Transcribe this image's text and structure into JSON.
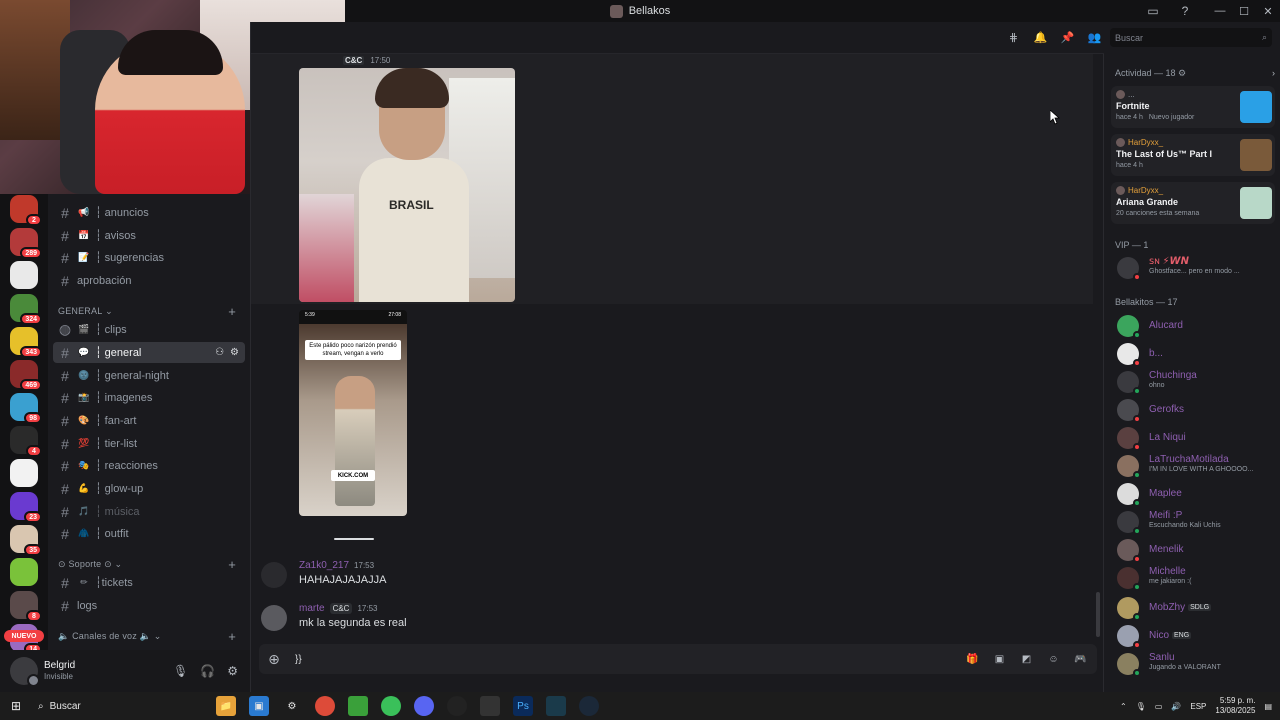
{
  "window": {
    "title": "Bellakos"
  },
  "header": {
    "search_placeholder": "Buscar"
  },
  "sidebar": {
    "channels_top": [
      {
        "label": "┆ anuncios",
        "emoji": "📢"
      },
      {
        "label": "┆ avisos",
        "emoji": "📅"
      },
      {
        "label": "┆ sugerencias",
        "emoji": "📝"
      },
      {
        "label": "aprobación",
        "emoji": ""
      }
    ],
    "cat_general": "GENERAL",
    "channels_general": [
      {
        "label": "┆ clips",
        "emoji": "🎬"
      },
      {
        "label": "┆ general",
        "emoji": "💬"
      },
      {
        "label": "┆ general-night",
        "emoji": "🌚"
      },
      {
        "label": "┆ imagenes",
        "emoji": "📸"
      },
      {
        "label": "┆ fan-art",
        "emoji": "🎨"
      },
      {
        "label": "┆ tier-list",
        "emoji": "💯"
      },
      {
        "label": "┆ reacciones",
        "emoji": "🎭"
      },
      {
        "label": "┆ glow-up",
        "emoji": "💪"
      },
      {
        "label": "┆ música",
        "emoji": "🎵"
      },
      {
        "label": "┆ outfit",
        "emoji": "🧥"
      }
    ],
    "cat_soporte": "Soporte",
    "channels_soporte": [
      {
        "label": "┆tickets",
        "emoji": "✏"
      },
      {
        "label": "logs",
        "emoji": ""
      }
    ],
    "cat_voz": "Canales de voz",
    "rail_badges": [
      "2",
      "289",
      "324",
      "343",
      "469",
      "98",
      "4",
      "23",
      "35",
      "8",
      "14"
    ],
    "rail_new": "NUEVO"
  },
  "user": {
    "name": "Belgrid",
    "status": "Invisible"
  },
  "chat": {
    "top_tag": "C&C",
    "top_time": "17:50",
    "image1_text": "BRASIL",
    "image2": {
      "status_time": "5:39",
      "status_rec": "27:08",
      "caption": "Este pálido poco narizón prendió stream, vengan a verlo",
      "watermark": "KICK.COM"
    },
    "messages": [
      {
        "author": "Za1k0_217",
        "time": "17:53",
        "text": "HAHAJAJAJAJJA",
        "tag": ""
      },
      {
        "author": "marte",
        "time": "17:53",
        "text": "mk la segunda es real",
        "tag": "C&C"
      }
    ],
    "composer_text": "}}"
  },
  "members": {
    "activity_header": "Actividad — 18",
    "activities": [
      {
        "user": "...",
        "game": "Fortnite",
        "sub1": "hace 4 h",
        "sub2": "Nuevo jugador"
      },
      {
        "user": "HarDyxx_",
        "game": "The Last of Us™ Part I",
        "sub1": "hace 4 h",
        "sub2": ""
      },
      {
        "user": "HarDyxx_",
        "game": "Ariana Grande",
        "sub1": "20 canciones esta semana",
        "sub2": ""
      }
    ],
    "vip_header": "VIP — 1",
    "vip": [
      {
        "name": "ꜱɴ ⚡𝙒𝙉",
        "status": "Ghostface... pero en modo ..."
      }
    ],
    "group_header": "Bellakitos — 17",
    "list": [
      {
        "name": "Alucard",
        "status": "",
        "badge": ""
      },
      {
        "name": "b...",
        "status": "",
        "badge": ""
      },
      {
        "name": "Chuchinga",
        "status": "ohno",
        "badge": ""
      },
      {
        "name": "Gerofks",
        "status": "",
        "badge": ""
      },
      {
        "name": "La Niqui",
        "status": "",
        "badge": ""
      },
      {
        "name": "LaTruchaMotilada",
        "status": "I'M IN LOVE WITH A GHOOOO...",
        "badge": ""
      },
      {
        "name": "Maplee",
        "status": "",
        "badge": ""
      },
      {
        "name": "Meifi :P",
        "status": "Escuchando Kali Uchis",
        "badge": ""
      },
      {
        "name": "Menelik",
        "status": "",
        "badge": ""
      },
      {
        "name": "Michelle",
        "status": "me jakiaron :(",
        "badge": ""
      },
      {
        "name": "MobZhy",
        "status": "",
        "badge": "SDLG"
      },
      {
        "name": "Nico",
        "status": "",
        "badge": "ENG"
      },
      {
        "name": "Sanlu",
        "status": "Jugando a VALORANT",
        "badge": ""
      }
    ]
  },
  "taskbar": {
    "search": "Buscar",
    "lang": "ESP",
    "time": "5:59 p. m.",
    "date": "13/08/2025"
  }
}
